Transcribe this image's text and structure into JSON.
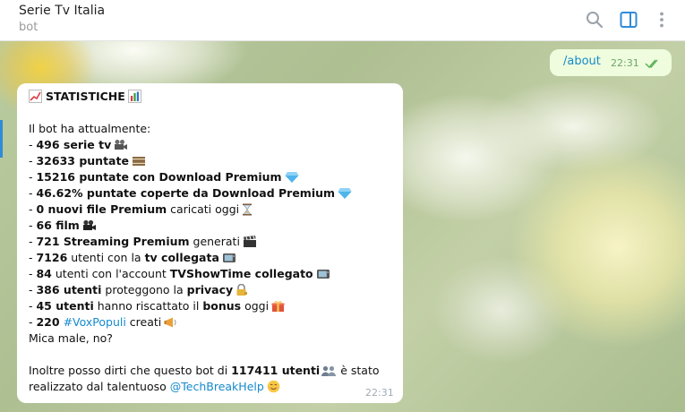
{
  "header": {
    "title": "Serie Tv Italia",
    "subtitle": "bot",
    "icons": [
      "search-icon",
      "side-panel-icon",
      "more-icon"
    ]
  },
  "colors": {
    "accent": "#2f8bd8",
    "outgoing_bg": "#effdde",
    "incoming_bg": "#ffffff",
    "link": "#168acd"
  },
  "outgoing": {
    "text": "/about",
    "time": "22:31",
    "status_icon": "double-check-icon"
  },
  "incoming": {
    "heading": "STATISTICHE",
    "intro": "Il bot ha attualmente:",
    "s1_num": "496 serie tv",
    "s2_num": "32633 puntate",
    "s3_num": "15216 puntate con Download Premium",
    "s4_num": "46.62% puntate coperte da Download Premium",
    "s5_num": "0 nuovi file Premium",
    "s5_rest": " caricati oggi",
    "s6_num": "66 film",
    "s7_num": "721 Streaming Premium",
    "s7_rest": " generati",
    "s8_num": "7126",
    "s8_mid": " utenti con la ",
    "s8_bold": "tv collegata",
    "s9_num": "84",
    "s9_mid": " utenti con l'account ",
    "s9_bold": "TVShowTime collegato",
    "s10_num": "386 utenti",
    "s10_mid": " proteggono la ",
    "s10_bold": "privacy",
    "s11_num": "45 utenti",
    "s11_mid": " hanno riscattato il ",
    "s11_bold": "bonus",
    "s11_rest": " oggi",
    "s12_num": "220",
    "s12_tag": "#VoxPopuli",
    "s12_rest": " creati",
    "closing": "Mica male, no?",
    "credit_pre": "Inoltre posso dirti che questo bot di ",
    "credit_num": "117411 utenti",
    "credit_post": " è stato",
    "credit2_pre": "realizzato dal talentuoso ",
    "credit2_link": "@TechBreakHelp",
    "time": "22:31"
  }
}
